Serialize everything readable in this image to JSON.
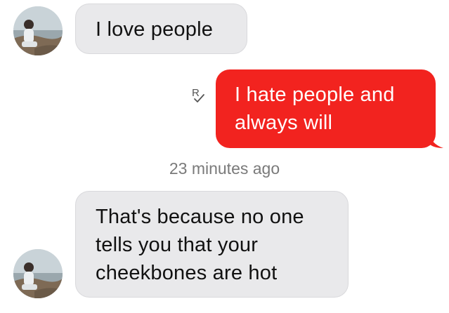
{
  "thread": {
    "messages": [
      {
        "direction": "incoming",
        "lines": [
          "I love people"
        ],
        "show_avatar": true
      },
      {
        "direction": "outgoing",
        "lines": [
          "I hate people and",
          "always will"
        ],
        "status_icon": "read-receipt-icon"
      },
      {
        "direction": "incoming",
        "lines": [
          "That's because no one",
          "tells you that your",
          "cheekbones are hot"
        ],
        "show_avatar": true
      }
    ],
    "timestamp": "23 minutes ago",
    "status_mark": "R"
  },
  "colors": {
    "incoming_bubble": "#e9e9eb",
    "outgoing_bubble": "#f2231f",
    "outgoing_text": "#ffffff",
    "timestamp_text": "#7a7a7a"
  }
}
